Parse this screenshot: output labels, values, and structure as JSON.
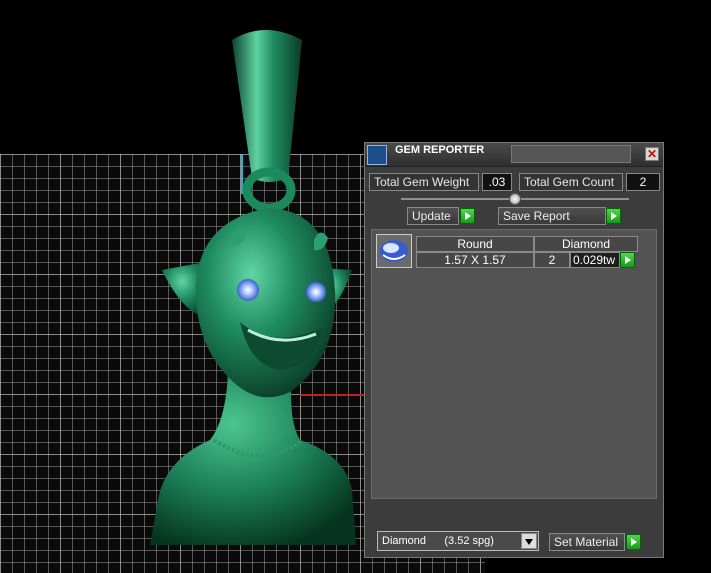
{
  "viewport": {
    "grid_color": "#969696",
    "model_color": "#1f7a58"
  },
  "gem_reporter": {
    "title": "GEM REPORTER",
    "close_symbol": "✕",
    "total_gem_weight_label": "Total Gem Weight",
    "total_gem_weight_value": ".03",
    "total_gem_count_label": "Total Gem Count",
    "total_gem_count_value": "2",
    "update_label": "Update",
    "save_report_label": "Save Report",
    "gem_table": {
      "headers": [
        "Round",
        "Diamond"
      ],
      "rows": [
        {
          "size": "1.57 X 1.57",
          "count": "2",
          "weight": "0.029tw"
        }
      ]
    },
    "material_select_value": "Diamond      (3.52 spg)",
    "set_material_label": "Set Material",
    "go_icon": "green-play-arrow-icon",
    "accent_color": "#22b022"
  }
}
